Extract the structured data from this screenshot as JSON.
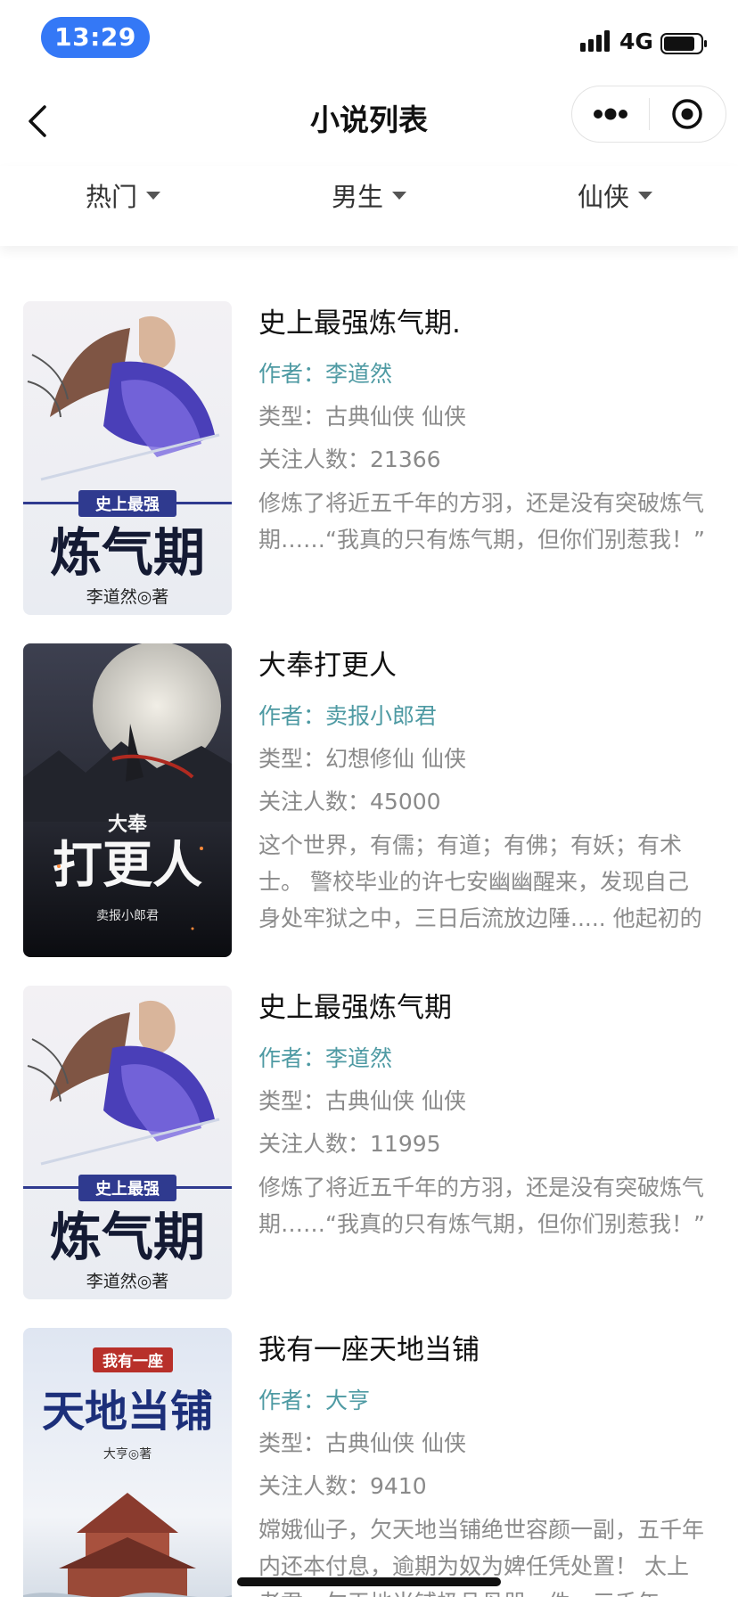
{
  "status_bar": {
    "time": "13:29",
    "network": "4G",
    "icons": [
      "signal-icon",
      "battery-icon"
    ]
  },
  "nav": {
    "title": "小说列表",
    "icons": [
      "back-icon",
      "more-icon",
      "close-icon"
    ]
  },
  "filters": [
    {
      "label": "热门"
    },
    {
      "label": "男生"
    },
    {
      "label": "仙侠"
    }
  ],
  "novels": [
    {
      "title": "史上最强炼气期.",
      "author_label": "作者：",
      "author": "李道然",
      "genre_label": "类型：",
      "genre": "古典仙侠 仙侠",
      "followers_label": "关注人数：",
      "followers": "21366",
      "desc": "修炼了将近五千年的方羽，还是没有突破炼气期……“我真的只有炼气期，但你们别惹我！”",
      "cover": {
        "line1": "史上最强",
        "line2": "炼气期",
        "author_text": "李道然◎著"
      }
    },
    {
      "title": "大奉打更人",
      "author_label": "作者：",
      "author": "卖报小郎君",
      "genre_label": "类型：",
      "genre": "幻想修仙 仙侠",
      "followers_label": "关注人数：",
      "followers": "45000",
      "desc": "这个世界，有儒；有道；有佛；有妖；有术士。 警校毕业的许七安幽幽醒来，发现自己身处牢狱之中，三日后流放边陲..... 他起初的目的只是自保，顺便在这个没有人权的社",
      "cover": {
        "line1": "大奉",
        "line2": "打更人",
        "author_text": "卖报小郎君"
      }
    },
    {
      "title": "史上最强炼气期",
      "author_label": "作者：",
      "author": "李道然",
      "genre_label": "类型：",
      "genre": "古典仙侠 仙侠",
      "followers_label": "关注人数：",
      "followers": "11995",
      "desc": "修炼了将近五千年的方羽，还是没有突破炼气期……“我真的只有炼气期，但你们别惹我！”",
      "cover": {
        "line1": "史上最强",
        "line2": "炼气期",
        "author_text": "李道然◎著"
      }
    },
    {
      "title": "我有一座天地当铺",
      "author_label": "作者：",
      "author": "大亨",
      "genre_label": "类型：",
      "genre": "古典仙侠 仙侠",
      "followers_label": "关注人数：",
      "followers": "9410",
      "desc": "嫦娥仙子，欠天地当铺绝世容颜一副，五千年内还本付息，逾期为奴为婢任凭处置！ 太上老君，欠天地当铺极品丹器一件，三千年",
      "cover": {
        "line1": "我有一座",
        "line2": "天地当铺",
        "author_text": "大亨◎著"
      }
    }
  ],
  "colors": {
    "accent_blue": "#3478f6",
    "author_teal": "#4e9aa3",
    "muted_text": "#8a8a8a"
  }
}
